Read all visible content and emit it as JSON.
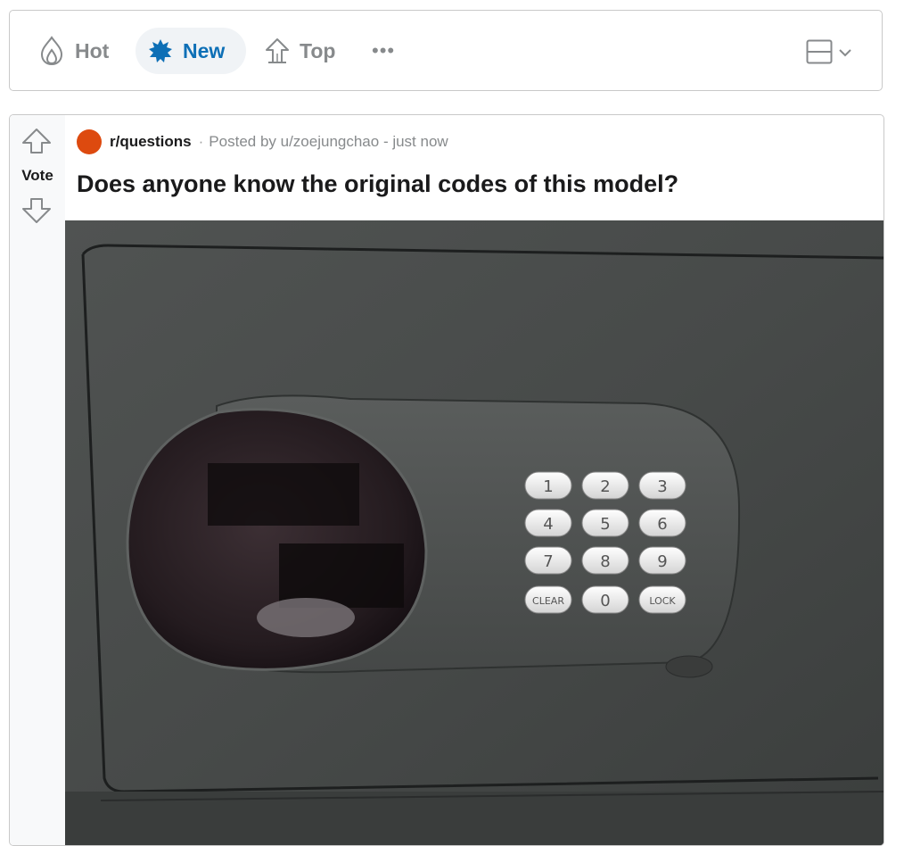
{
  "sort_bar": {
    "hot": {
      "label": "Hot",
      "icon": "flame-icon"
    },
    "new": {
      "label": "New",
      "icon": "burst-icon",
      "active": true
    },
    "top": {
      "label": "Top",
      "icon": "top-chart-icon"
    },
    "more_label": "•••",
    "layout_icon": "card-layout-icon"
  },
  "post": {
    "vote_label": "Vote",
    "subreddit": "r/questions",
    "separator": "·",
    "posted_by": "Posted by u/zoejungchao - just now",
    "title": "Does anyone know the original codes of this model?",
    "image": {
      "keypad_keys": [
        "1",
        "2",
        "3",
        "4",
        "5",
        "6",
        "7",
        "8",
        "9",
        "CLEAR",
        "0",
        "LOCK"
      ]
    }
  },
  "colors": {
    "accent": "#0d6fb6",
    "subreddit_avatar": "#dd4a0f",
    "muted": "#878a8c",
    "text": "#1a1a1b"
  }
}
